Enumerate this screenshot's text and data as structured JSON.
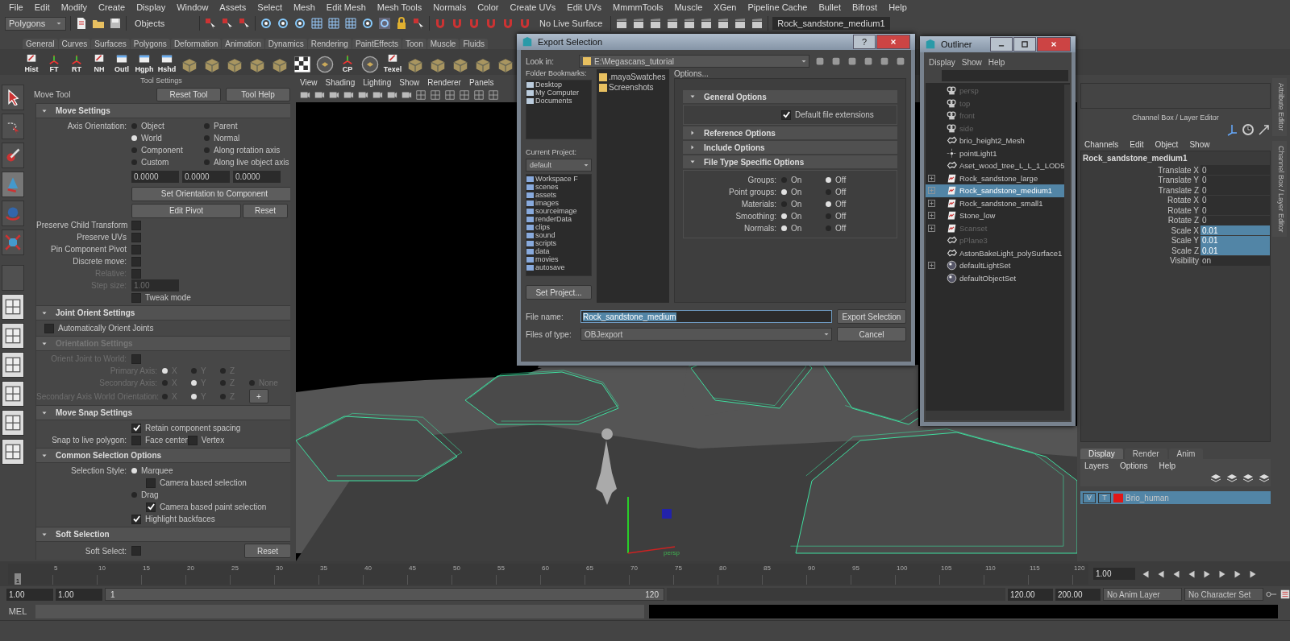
{
  "menu_bar": [
    "File",
    "Edit",
    "Modify",
    "Create",
    "Display",
    "Window",
    "Assets",
    "Select",
    "Mesh",
    "Edit Mesh",
    "Mesh Tools",
    "Normals",
    "Color",
    "Create UVs",
    "Edit UVs",
    "MmmmTools",
    "Muscle",
    "XGen",
    "Pipeline Cache",
    "Bullet",
    "Bifrost",
    "Help"
  ],
  "status_line": {
    "menu_set": "Polygons",
    "selection_mode": "Objects",
    "live_surface": "No Live Surface",
    "name_field": "Rock_sandstone_medium1"
  },
  "shelf": {
    "tabs": [
      "General",
      "Curves",
      "Surfaces",
      "Polygons",
      "Deformation",
      "Animation",
      "Dynamics",
      "Rendering",
      "PaintEffects",
      "Toon",
      "Muscle",
      "Fluids"
    ],
    "items": [
      {
        "kind": "doc",
        "label": "Hist"
      },
      {
        "kind": "axes",
        "label": "FT"
      },
      {
        "kind": "axes",
        "label": "RT"
      },
      {
        "kind": "doc",
        "label": "NH"
      },
      {
        "kind": "window",
        "label": "Outl"
      },
      {
        "kind": "window",
        "label": "Hgph"
      },
      {
        "kind": "window",
        "label": "Hshd"
      },
      {
        "kind": "cube"
      },
      {
        "kind": "cube"
      },
      {
        "kind": "cube"
      },
      {
        "kind": "cube"
      },
      {
        "kind": "cube"
      },
      {
        "kind": "checker"
      },
      {
        "kind": "circle"
      },
      {
        "kind": "axes",
        "label": "CP"
      },
      {
        "kind": "circle"
      },
      {
        "kind": "doc",
        "label": "Texel"
      },
      {
        "kind": "cube"
      },
      {
        "kind": "cube"
      },
      {
        "kind": "cube"
      },
      {
        "kind": "cube"
      },
      {
        "kind": "cube"
      }
    ]
  },
  "tool_settings": {
    "title": "Tool Settings",
    "tool_name": "Move Tool",
    "buttons": [
      "Reset Tool",
      "Tool Help"
    ],
    "sections": [
      {
        "title": "Move Settings",
        "expanded": true,
        "disabled": false,
        "rows": [
          {
            "kind": "radio",
            "label": "Axis Orientation:",
            "options": [
              {
                "label": "Object",
                "selected": false
              },
              {
                "label": "Parent",
                "selected": false
              }
            ]
          },
          {
            "kind": "radio",
            "options": [
              {
                "label": "World",
                "selected": true
              },
              {
                "label": "Normal",
                "selected": false
              }
            ]
          },
          {
            "kind": "radio",
            "options": [
              {
                "label": "Component",
                "selected": false
              },
              {
                "label": "Along rotation axis",
                "selected": false
              }
            ]
          },
          {
            "kind": "radio",
            "options": [
              {
                "label": "Custom",
                "selected": false
              },
              {
                "label": "Along live object axis",
                "selected": false
              }
            ]
          },
          {
            "kind": "fields",
            "values": [
              "0.0000",
              "0.0000",
              "0.0000"
            ]
          },
          {
            "kind": "buttons",
            "buttons": [
              "Set Orientation to Component"
            ]
          },
          {
            "kind": "buttons",
            "buttons": [
              "Edit Pivot",
              "Reset"
            ]
          },
          {
            "kind": "checkbox",
            "label": "Preserve Child Transform",
            "checked": false
          },
          {
            "kind": "checkbox",
            "label": "Preserve UVs",
            "checked": false
          },
          {
            "kind": "checkbox",
            "label": "Pin Component Pivot",
            "checked": false
          },
          {
            "kind": "checkbox",
            "label": "Discrete move:",
            "checked": false
          },
          {
            "kind": "checkbox",
            "label": "Relative:",
            "checked": false,
            "disabled": true
          },
          {
            "kind": "field",
            "label": "Step size:",
            "value": "1.00",
            "disabled": true
          },
          {
            "kind": "checks",
            "options": [
              {
                "label": "Tweak mode",
                "selected": false
              }
            ]
          }
        ]
      },
      {
        "title": "Joint Orient Settings",
        "expanded": true,
        "disabled": false,
        "rows": [
          {
            "kind": "checks",
            "flush": true,
            "options": [
              {
                "label": "Automatically Orient Joints",
                "selected": false
              }
            ]
          }
        ]
      },
      {
        "title": "Orientation Settings",
        "expanded": true,
        "disabled": true,
        "rows": [
          {
            "kind": "checkbox",
            "label": "Orient Joint to World:",
            "checked": false,
            "disabled": true
          },
          {
            "kind": "radio",
            "label": "Primary Axis:",
            "disabled": true,
            "options": [
              {
                "label": "X",
                "selected": true
              },
              {
                "label": "Y",
                "selected": false
              },
              {
                "label": "Z",
                "selected": false
              }
            ]
          },
          {
            "kind": "radio",
            "label": "Secondary Axis:",
            "disabled": true,
            "options": [
              {
                "label": "X",
                "selected": false
              },
              {
                "label": "Y",
                "selected": true
              },
              {
                "label": "Z",
                "selected": false
              },
              {
                "label": "None",
                "selected": false
              }
            ]
          },
          {
            "kind": "radio",
            "label": "Secondary Axis World Orientation:",
            "disabled": true,
            "options": [
              {
                "label": "X",
                "selected": false
              },
              {
                "label": "Y",
                "selected": true
              },
              {
                "label": "Z",
                "selected": false
              }
            ],
            "button": "+"
          }
        ]
      },
      {
        "title": "Move Snap Settings",
        "expanded": true,
        "disabled": false,
        "rows": [
          {
            "kind": "checks",
            "options": [
              {
                "label": "Retain component spacing",
                "selected": true
              }
            ]
          },
          {
            "kind": "checks",
            "label": "Snap to live polygon:",
            "options": [
              {
                "label": "Face center",
                "selected": false
              },
              {
                "label": "Vertex",
                "selected": false
              }
            ]
          }
        ]
      },
      {
        "title": "Common Selection Options",
        "expanded": true,
        "disabled": false,
        "rows": [
          {
            "kind": "radio",
            "label": "Selection Style:",
            "options": [
              {
                "label": "Marquee",
                "selected": true
              }
            ]
          },
          {
            "kind": "checks",
            "indented": true,
            "options": [
              {
                "label": "Camera based selection",
                "selected": false
              }
            ]
          },
          {
            "kind": "radio",
            "options": [
              {
                "label": "Drag",
                "selected": false
              }
            ]
          },
          {
            "kind": "checks",
            "indented": true,
            "options": [
              {
                "label": "Camera based paint selection",
                "selected": true
              }
            ]
          },
          {
            "kind": "checks",
            "options": [
              {
                "label": "Highlight backfaces",
                "selected": true
              }
            ]
          }
        ]
      },
      {
        "title": "Soft Selection",
        "expanded": true,
        "disabled": false,
        "rows": [
          {
            "kind": "checkbox",
            "label": "Soft Select:",
            "checked": false,
            "button": "Reset"
          }
        ]
      }
    ]
  },
  "viewport": {
    "menu": [
      "View",
      "Shading",
      "Lighting",
      "Show",
      "Renderer",
      "Panels"
    ],
    "camera": "persp"
  },
  "export_dialog": {
    "title": "Export Selection",
    "help_button": "?",
    "look_in_label": "Look in:",
    "look_in": "E:\\Megascans_tutorial",
    "bookmarks_label": "Folder Bookmarks:",
    "bookmarks": [
      "Desktop",
      "My Computer",
      "Documents"
    ],
    "files": [
      ".mayaSwatches",
      "Screenshots"
    ],
    "current_project_label": "Current Project:",
    "project": "default",
    "project_folders": [
      "Workspace F",
      "scenes",
      "assets",
      "images",
      "sourceimage",
      "renderData",
      "clips",
      "sound",
      "scripts",
      "data",
      "movies",
      "autosave"
    ],
    "set_project": "Set Project...",
    "options_label": "Options...",
    "option_sections": [
      {
        "title": "General Options",
        "expanded": true,
        "rows": [
          {
            "kind": "checks",
            "options": [
              {
                "label": "Default file extensions",
                "selected": true
              }
            ]
          }
        ]
      },
      {
        "title": "Reference Options",
        "expanded": false
      },
      {
        "title": "Include Options",
        "expanded": false
      },
      {
        "title": "File Type Specific Options",
        "expanded": true,
        "rows": [
          {
            "kind": "radio",
            "label": "Groups:",
            "options": [
              {
                "label": "On",
                "selected": false
              },
              {
                "label": "Off",
                "selected": true
              }
            ]
          },
          {
            "kind": "radio",
            "label": "Point groups:",
            "options": [
              {
                "label": "On",
                "selected": true
              },
              {
                "label": "Off",
                "selected": false
              }
            ]
          },
          {
            "kind": "radio",
            "label": "Materials:",
            "options": [
              {
                "label": "On",
                "selected": false
              },
              {
                "label": "Off",
                "selected": true
              }
            ]
          },
          {
            "kind": "radio",
            "label": "Smoothing:",
            "options": [
              {
                "label": "On",
                "selected": true
              },
              {
                "label": "Off",
                "selected": false
              }
            ]
          },
          {
            "kind": "radio",
            "label": "Normals:",
            "options": [
              {
                "label": "On",
                "selected": true
              },
              {
                "label": "Off",
                "selected": false
              }
            ]
          }
        ]
      }
    ],
    "file_name_label": "File name:",
    "file_name": "Rock_sandstone_medium",
    "file_name_highlighted": true,
    "file_type_label": "Files of type:",
    "file_type": "OBJexport",
    "buttons": [
      "Export Selection",
      "Cancel"
    ]
  },
  "outliner": {
    "title": "Outliner",
    "menu": [
      "Display",
      "Show",
      "Help"
    ],
    "items": [
      {
        "label": "persp",
        "kind": "camera",
        "dimmed": true,
        "expandable": false,
        "selected": false
      },
      {
        "label": "top",
        "kind": "camera",
        "dimmed": true,
        "expandable": false,
        "selected": false
      },
      {
        "label": "front",
        "kind": "camera",
        "dimmed": true,
        "expandable": false,
        "selected": false
      },
      {
        "label": "side",
        "kind": "camera",
        "dimmed": true,
        "expandable": false,
        "selected": false
      },
      {
        "label": "brio_height2_Mesh",
        "kind": "mesh",
        "dimmed": false,
        "expandable": false,
        "selected": false
      },
      {
        "label": "pointLight1",
        "kind": "light",
        "dimmed": false,
        "expandable": false,
        "selected": false
      },
      {
        "label": "Aset_wood_tree_L_L_1_LOD5",
        "kind": "mesh",
        "dimmed": false,
        "expandable": false,
        "selected": false
      },
      {
        "label": "Rock_sandstone_large",
        "kind": "transform",
        "dimmed": false,
        "expandable": true,
        "selected": false
      },
      {
        "label": "Rock_sandstone_medium1",
        "kind": "transform",
        "dimmed": false,
        "expandable": true,
        "selected": true
      },
      {
        "label": "Rock_sandstone_small1",
        "kind": "transform",
        "dimmed": false,
        "expandable": true,
        "selected": false
      },
      {
        "label": "Stone_low",
        "kind": "transform",
        "dimmed": false,
        "expandable": true,
        "selected": false
      },
      {
        "label": "Scanset",
        "kind": "transform",
        "dimmed": true,
        "expandable": true,
        "selected": false
      },
      {
        "label": "pPlane3",
        "kind": "mesh",
        "dimmed": true,
        "expandable": false,
        "selected": false
      },
      {
        "label": "AstonBakeLight_polySurface1",
        "kind": "mesh",
        "dimmed": false,
        "expandable": false,
        "selected": false
      },
      {
        "label": "defaultLightSet",
        "kind": "set",
        "dimmed": false,
        "expandable": true,
        "selected": false
      },
      {
        "label": "defaultObjectSet",
        "kind": "set",
        "dimmed": false,
        "expandable": false,
        "selected": false
      }
    ]
  },
  "channel_box": {
    "title": "Channel Box / Layer Editor",
    "menu": [
      "Channels",
      "Edit",
      "Object",
      "Show"
    ],
    "object": "Rock_sandstone_medium1",
    "channels": [
      {
        "name": "Translate X",
        "value": "0",
        "selected": false
      },
      {
        "name": "Translate Y",
        "value": "0",
        "selected": false
      },
      {
        "name": "Translate Z",
        "value": "0",
        "selected": false
      },
      {
        "name": "Rotate X",
        "value": "0",
        "selected": false
      },
      {
        "name": "Rotate Y",
        "value": "0",
        "selected": false
      },
      {
        "name": "Rotate Z",
        "value": "0",
        "selected": false
      },
      {
        "name": "Scale X",
        "value": "0.01",
        "selected": true
      },
      {
        "name": "Scale Y",
        "value": "0.01",
        "selected": true
      },
      {
        "name": "Scale Z",
        "value": "0.01",
        "selected": true
      },
      {
        "name": "Visibility",
        "value": "on",
        "selected": false
      }
    ],
    "layer_tabs": [
      {
        "label": "Display",
        "selected": true
      },
      {
        "label": "Render",
        "selected": false
      },
      {
        "label": "Anim",
        "selected": false
      }
    ],
    "layer_menu": [
      "Layers",
      "Options",
      "Help"
    ],
    "layers": [
      {
        "visible": "V",
        "template": "T",
        "name": "Brio_human",
        "color": "#e01818",
        "selected": true
      }
    ]
  },
  "side_tabs": [
    "Attribute Editor",
    "Channel Box / Layer Editor"
  ],
  "timeline": {
    "ticks": [
      "5",
      "10",
      "15",
      "20",
      "25",
      "30",
      "35",
      "40",
      "45",
      "50",
      "55",
      "60",
      "65",
      "70",
      "75",
      "80",
      "85",
      "90",
      "95",
      "100",
      "105",
      "110",
      "115",
      "120"
    ],
    "current_frame": "1",
    "current_time": "1.00"
  },
  "range": {
    "start": "1.00",
    "playback_start": "1.00",
    "slider_start": "1",
    "slider_end": "120",
    "playback_end": "120.00",
    "end": "200.00",
    "anim_layer": "No Anim Layer",
    "character_set": "No Character Set"
  },
  "command_line": {
    "label": "MEL"
  }
}
